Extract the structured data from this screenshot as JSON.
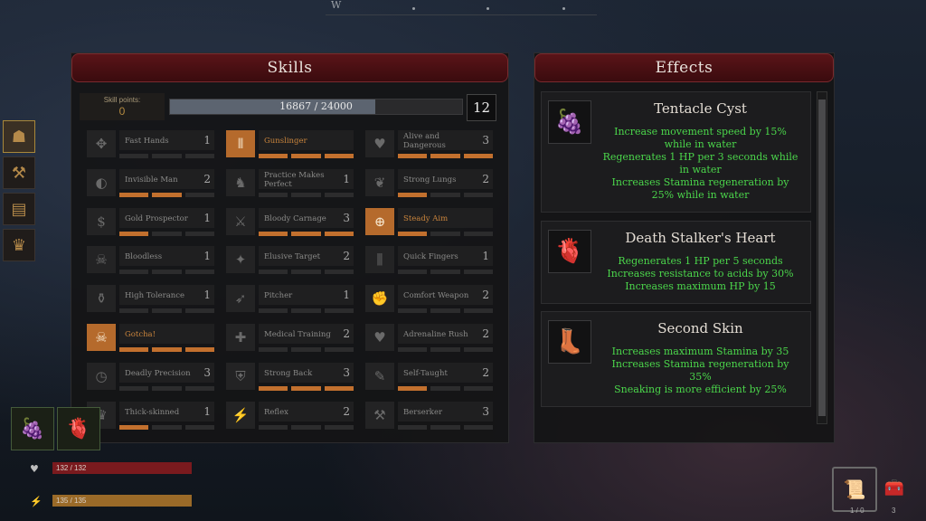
{
  "compass": {
    "heading": "W"
  },
  "skills_panel": {
    "title": "Skills",
    "skill_points_label": "Skill points:",
    "skill_points_value": "0",
    "xp_text": "16867 / 24000",
    "xp_fraction": 0.703,
    "level": "12"
  },
  "skills": [
    {
      "name": "Fast Hands",
      "level": "1",
      "pips": [
        0,
        0,
        0
      ],
      "lit": false,
      "icon": "✥"
    },
    {
      "name": "Gunslinger",
      "level": "",
      "pips": [
        1,
        1,
        1
      ],
      "lit": true,
      "icon": "⦀"
    },
    {
      "name": "Alive and Dangerous",
      "level": "3",
      "pips": [
        1,
        1,
        1
      ],
      "lit": false,
      "icon": "♥"
    },
    {
      "name": "Invisible Man",
      "level": "2",
      "pips": [
        1,
        1,
        0
      ],
      "lit": false,
      "icon": "◐"
    },
    {
      "name": "Practice Makes Perfect",
      "level": "1",
      "pips": [
        0,
        0,
        0
      ],
      "lit": false,
      "icon": "♞"
    },
    {
      "name": "Strong Lungs",
      "level": "2",
      "pips": [
        1,
        0,
        0
      ],
      "lit": false,
      "icon": "❦"
    },
    {
      "name": "Gold Prospector",
      "level": "1",
      "pips": [
        1,
        0,
        0
      ],
      "lit": false,
      "icon": "$"
    },
    {
      "name": "Bloody Carnage",
      "level": "3",
      "pips": [
        1,
        1,
        1
      ],
      "lit": false,
      "icon": "⚔"
    },
    {
      "name": "Steady Aim",
      "level": "",
      "pips": [
        1,
        0,
        0
      ],
      "lit": true,
      "icon": "⊕"
    },
    {
      "name": "Bloodless",
      "level": "1",
      "pips": [
        0,
        0,
        0
      ],
      "lit": false,
      "icon": "☠"
    },
    {
      "name": "Elusive Target",
      "level": "2",
      "pips": [
        0,
        0,
        0
      ],
      "lit": false,
      "icon": "✦"
    },
    {
      "name": "Quick Fingers",
      "level": "1",
      "pips": [
        0,
        0,
        0
      ],
      "lit": false,
      "icon": "⫼"
    },
    {
      "name": "High Tolerance",
      "level": "1",
      "pips": [
        0,
        0,
        0
      ],
      "lit": false,
      "icon": "⚱"
    },
    {
      "name": "Pitcher",
      "level": "1",
      "pips": [
        0,
        0,
        0
      ],
      "lit": false,
      "icon": "➶"
    },
    {
      "name": "Comfort Weapon",
      "level": "2",
      "pips": [
        0,
        0,
        0
      ],
      "lit": false,
      "icon": "✊"
    },
    {
      "name": "Gotcha!",
      "level": "",
      "pips": [
        1,
        1,
        1
      ],
      "lit": true,
      "icon": "☠"
    },
    {
      "name": "Medical Training",
      "level": "2",
      "pips": [
        0,
        0,
        0
      ],
      "lit": false,
      "icon": "✚"
    },
    {
      "name": "Adrenaline Rush",
      "level": "2",
      "pips": [
        0,
        0,
        0
      ],
      "lit": false,
      "icon": "♥"
    },
    {
      "name": "Deadly Precision",
      "level": "3",
      "pips": [
        0,
        0,
        0
      ],
      "lit": false,
      "icon": "◷"
    },
    {
      "name": "Strong Back",
      "level": "3",
      "pips": [
        1,
        1,
        1
      ],
      "lit": false,
      "icon": "⛨"
    },
    {
      "name": "Self-Taught",
      "level": "2",
      "pips": [
        1,
        0,
        0
      ],
      "lit": false,
      "icon": "✎"
    },
    {
      "name": "Thick-skinned",
      "level": "1",
      "pips": [
        1,
        0,
        0
      ],
      "lit": false,
      "icon": "♛"
    },
    {
      "name": "Reflex",
      "level": "2",
      "pips": [
        0,
        0,
        0
      ],
      "lit": false,
      "icon": "⚡"
    },
    {
      "name": "Berserker",
      "level": "3",
      "pips": [
        0,
        0,
        0
      ],
      "lit": false,
      "icon": "⚒"
    }
  ],
  "effects_panel": {
    "title": "Effects",
    "items": [
      {
        "title": "Tentacle Cyst",
        "icon": "🍇",
        "lines": [
          "Increase movement speed by 15%",
          "while in water",
          "Regenerates 1 HP per 3 seconds while",
          "in water",
          "Increases Stamina regeneration by",
          "25% while in water"
        ]
      },
      {
        "title": "Death Stalker's Heart",
        "icon": "🫀",
        "lines": [
          "Regenerates 1 HP per 5 seconds",
          "Increases resistance to acids by 30%",
          "Increases maximum HP by 15"
        ]
      },
      {
        "title": "Second Skin",
        "icon": "👢",
        "lines": [
          "Increases maximum Stamina by 35",
          "Increases Stamina regeneration by",
          "35%",
          "Sneaking is more efficient by 25%"
        ]
      }
    ]
  },
  "hud": {
    "health_text": "132 / 132",
    "health_color": "#7a1a1e",
    "stamina_text": "135 / 135",
    "stamina_color": "#9a6a28",
    "slot_counts": [
      "1 / 0",
      "3"
    ]
  }
}
